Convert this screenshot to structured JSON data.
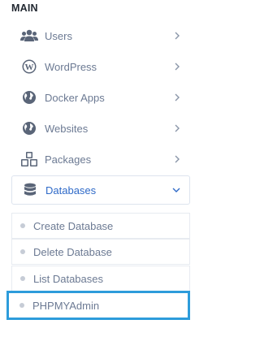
{
  "sidebar": {
    "section_title": "MAIN",
    "items": [
      {
        "label": "Users",
        "icon": "users-icon"
      },
      {
        "label": "WordPress",
        "icon": "wordpress-icon"
      },
      {
        "label": "Docker Apps",
        "icon": "globe-icon"
      },
      {
        "label": "Websites",
        "icon": "globe-icon"
      },
      {
        "label": "Packages",
        "icon": "cubes-icon"
      },
      {
        "label": "Databases",
        "icon": "database-icon",
        "active": true
      }
    ],
    "submenu": [
      {
        "label": "Create Database"
      },
      {
        "label": "Delete Database"
      },
      {
        "label": "List Databases"
      },
      {
        "label": "PHPMYAdmin",
        "selected": true
      }
    ]
  },
  "colors": {
    "icon": "#5a6578",
    "text": "#6c7a93",
    "active_text": "#2f6ac8",
    "highlight_border": "#2d9cdb"
  }
}
